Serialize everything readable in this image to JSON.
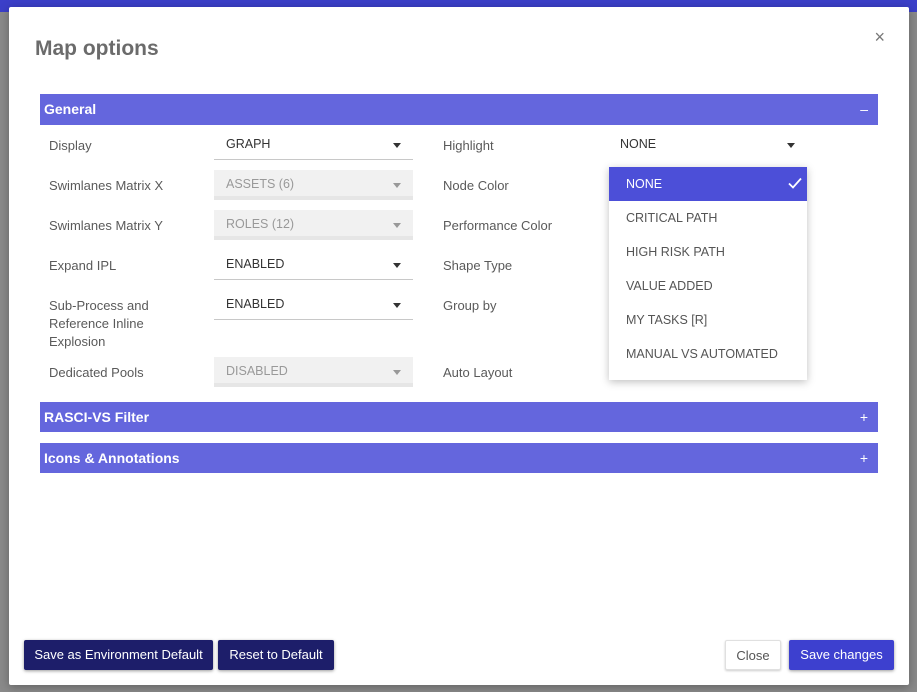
{
  "modal": {
    "title": "Map options",
    "close_glyph": "×"
  },
  "sections": {
    "general": {
      "label": "General",
      "toggle": "–"
    },
    "rasci": {
      "label": "RASCI-VS Filter",
      "toggle": "+"
    },
    "icons": {
      "label": "Icons & Annotations",
      "toggle": "+"
    }
  },
  "left_fields": [
    {
      "label": "Display",
      "value": "GRAPH",
      "disabled": false
    },
    {
      "label": "Swimlanes Matrix X",
      "value": "ASSETS (6)",
      "disabled": true
    },
    {
      "label": "Swimlanes Matrix Y",
      "value": "ROLES (12)",
      "disabled": true
    },
    {
      "label": "Expand IPL",
      "value": "ENABLED",
      "disabled": false
    },
    {
      "label": "Sub-Process and Reference Inline Explosion",
      "value": "ENABLED",
      "disabled": false
    },
    {
      "label": "Dedicated Pools",
      "value": "DISABLED",
      "disabled": true
    }
  ],
  "right_fields": [
    {
      "label": "Highlight",
      "value": "NONE"
    },
    {
      "label": "Node Color"
    },
    {
      "label": "Performance Color"
    },
    {
      "label": "Shape Type"
    },
    {
      "label": "Group by"
    },
    {
      "label": "Auto Layout"
    }
  ],
  "highlight_dropdown": {
    "options": [
      "NONE",
      "CRITICAL PATH",
      "HIGH RISK PATH",
      "VALUE ADDED",
      "MY TASKS [R]",
      "MANUAL VS AUTOMATED"
    ],
    "selected": "NONE"
  },
  "footer": {
    "save_env_default": "Save as Environment Default",
    "reset_default": "Reset to Default",
    "close": "Close",
    "save_changes": "Save changes"
  },
  "colors": {
    "accent": "#6466dd",
    "selected": "#4c4fd8",
    "dark_button": "#1d1e6a",
    "primary_button": "#3d40cf"
  }
}
